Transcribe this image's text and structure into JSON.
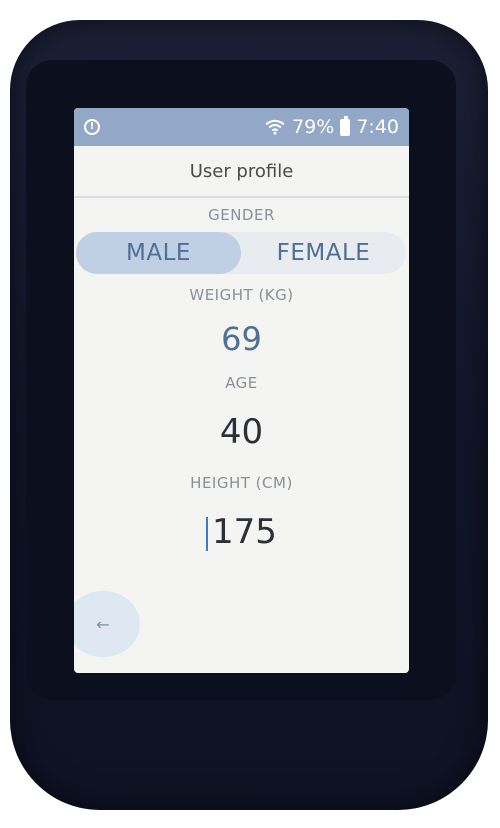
{
  "statusbar": {
    "info_icon": "info-icon",
    "wifi_icon": "wifi-icon",
    "battery_percent": "79%",
    "battery_icon": "battery-icon",
    "time": "7:40"
  },
  "header": {
    "title": "User profile"
  },
  "gender": {
    "label": "GENDER",
    "options": [
      "MALE",
      "FEMALE"
    ],
    "selected": "MALE"
  },
  "weight": {
    "label": "WEIGHT (KG)",
    "value": "69"
  },
  "age": {
    "label": "AGE",
    "value": "40"
  },
  "height": {
    "label": "HEIGHT (CM)",
    "value": "175"
  },
  "back": {
    "icon": "arrow-left-icon",
    "glyph": "←"
  },
  "colors": {
    "statusbar": "#93a7c7",
    "screen": "#f4f4f2",
    "accent": "#4f6f94",
    "selected_toggle": "#bfd0e4",
    "device_body": "#12152a"
  }
}
